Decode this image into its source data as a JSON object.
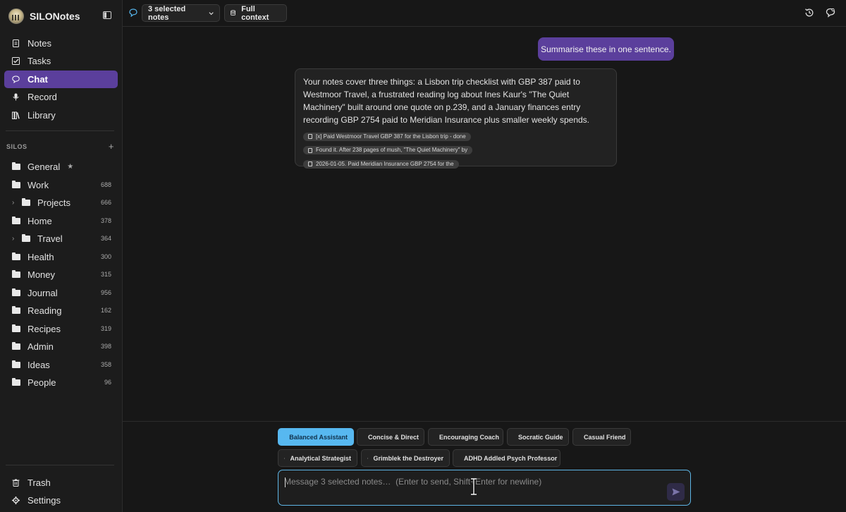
{
  "app": {
    "name": "SILONotes"
  },
  "nav": {
    "items": [
      {
        "label": "Notes",
        "icon": "document-icon"
      },
      {
        "label": "Tasks",
        "icon": "checkbox-icon"
      },
      {
        "label": "Chat",
        "icon": "chat-bubble-icon",
        "active": true
      },
      {
        "label": "Record",
        "icon": "microphone-icon"
      },
      {
        "label": "Library",
        "icon": "library-icon"
      }
    ],
    "bottom": [
      {
        "label": "Trash",
        "icon": "trash-icon"
      },
      {
        "label": "Settings",
        "icon": "gear-icon"
      }
    ]
  },
  "silos": {
    "heading": "SILOS",
    "add_label": "+",
    "items": [
      {
        "name": "General",
        "count": "",
        "starred": true,
        "star": "★"
      },
      {
        "name": "Work",
        "count": "688"
      },
      {
        "name": "Projects",
        "count": "666",
        "expandable": true,
        "chevron": "›"
      },
      {
        "name": "Home",
        "count": "378"
      },
      {
        "name": "Travel",
        "count": "364",
        "expandable": true,
        "chevron": "›"
      },
      {
        "name": "Health",
        "count": "300"
      },
      {
        "name": "Money",
        "count": "315"
      },
      {
        "name": "Journal",
        "count": "956"
      },
      {
        "name": "Reading",
        "count": "162"
      },
      {
        "name": "Recipes",
        "count": "319"
      },
      {
        "name": "Admin",
        "count": "398"
      },
      {
        "name": "Ideas",
        "count": "358"
      },
      {
        "name": "People",
        "count": "96"
      }
    ]
  },
  "topbar": {
    "selection_label": "3 selected notes",
    "context_label": "Full context"
  },
  "messages": {
    "user": "Summarise these in one sentence.",
    "assistant": "Your notes cover three things: a Lisbon trip checklist with GBP 387 paid to Westmoor Travel, a frustrated reading log about Ines Kaur's \"The Quiet Machinery\" built around one quote on p.239, and a January finances entry recording GBP 2754 paid to Meridian Insurance plus smaller weekly spends.",
    "sources": [
      "[x] Paid Westmoor Travel GBP 387 for the Lisbon trip - done",
      "Found it. After 238 pages of mush, \"The Quiet Machinery\" by",
      "2026-01-05. Paid Meridian Insurance GBP 2754 for the"
    ]
  },
  "personas": {
    "row1": [
      "Balanced Assistant",
      "Concise & Direct",
      "Encouraging Coach",
      "Socratic Guide",
      "Casual Friend"
    ],
    "row2": [
      "Analytical Strategist",
      "Grimblek the Destroyer",
      "ADHD Addled Psych Professor"
    ],
    "active": "Balanced Assistant"
  },
  "composer": {
    "placeholder": "Message 3 selected notes…  (Enter to send, Shift+Enter for newline)",
    "value": ""
  },
  "colors": {
    "accent_purple": "#5b3f9c",
    "active_persona": "#57b8f0",
    "input_border": "#5eb6e6",
    "background": "#171717"
  }
}
